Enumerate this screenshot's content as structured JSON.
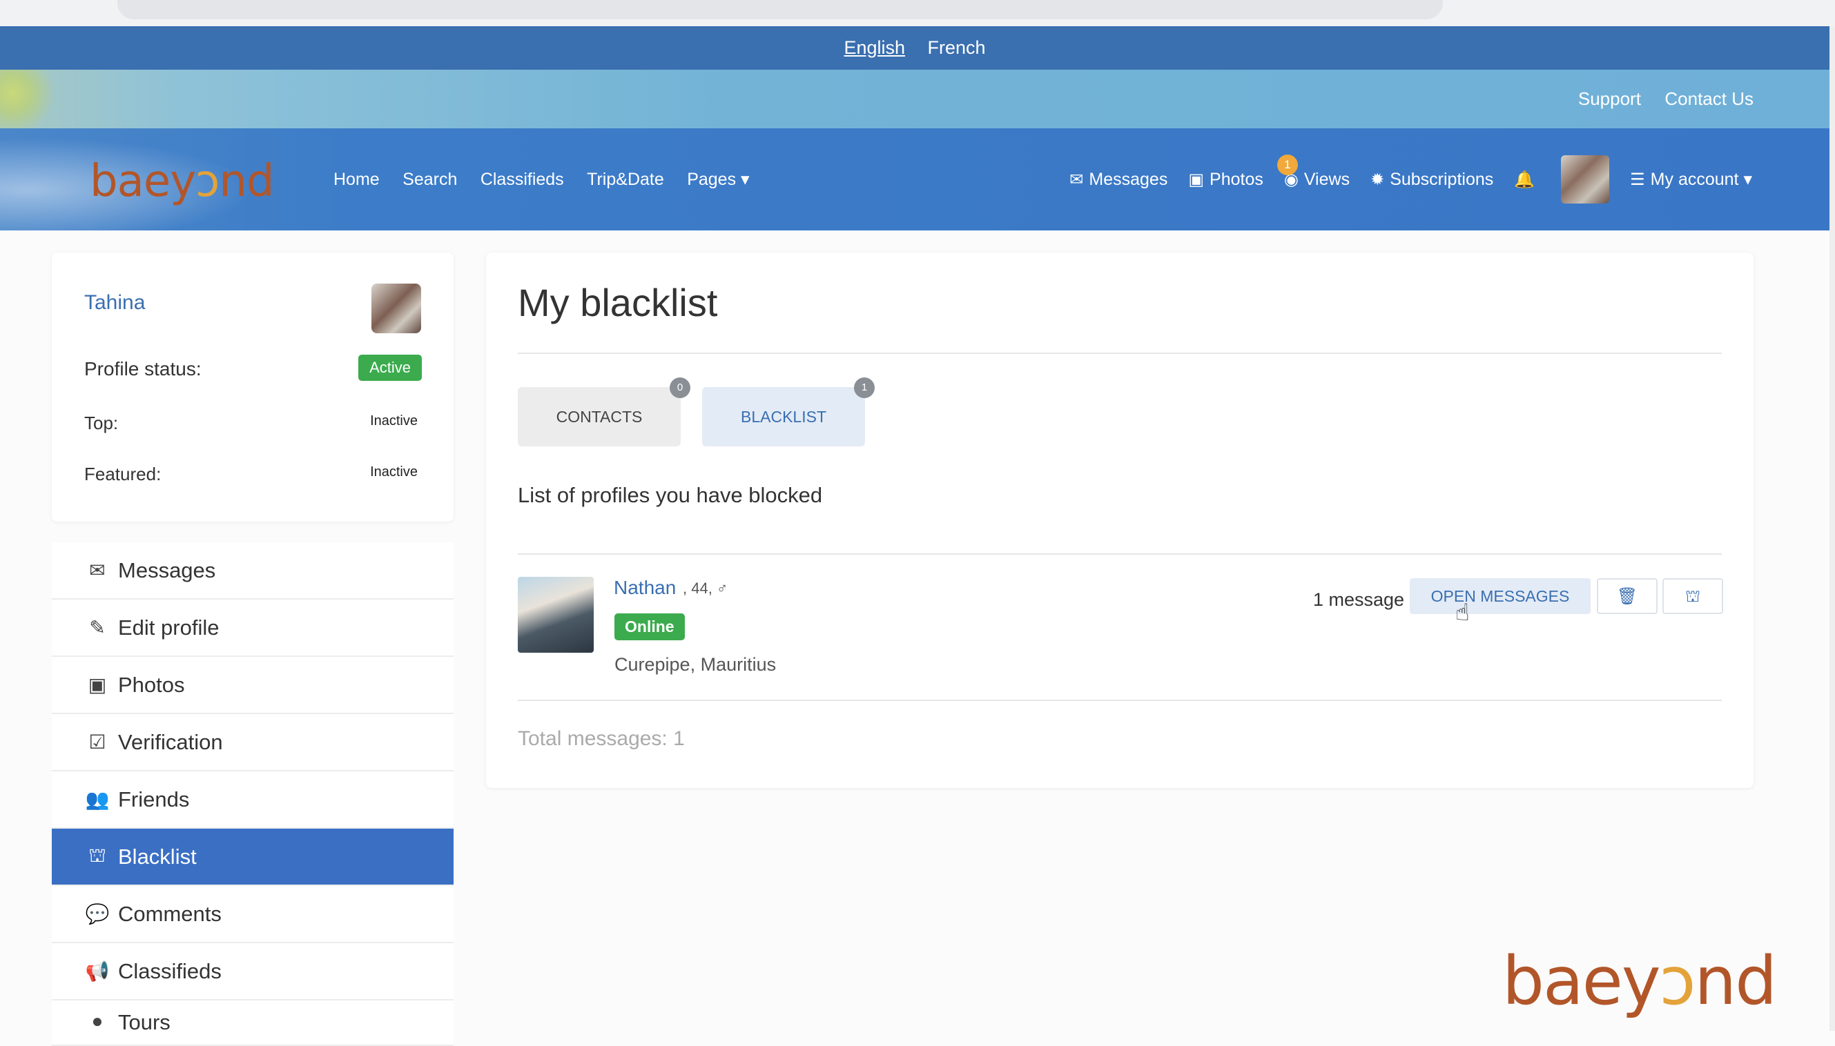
{
  "language_bar": {
    "english": "English",
    "french": "French"
  },
  "top_links": {
    "support": "Support",
    "contact": "Contact Us"
  },
  "brand": {
    "logo_text_a": "baey",
    "logo_text_o": "ɔ",
    "logo_text_b": "nd"
  },
  "nav": {
    "home": "Home",
    "search": "Search",
    "classifieds": "Classifieds",
    "tripdate": "Trip&Date",
    "pages": "Pages ▾",
    "messages": "Messages",
    "photos": "Photos",
    "views": "Views",
    "views_badge": "1",
    "subscriptions": "Subscriptions",
    "my_account": "My account ▾"
  },
  "profile": {
    "name": "Tahina",
    "status_label": "Profile status:",
    "status_value": "Active",
    "top_label": "Top:",
    "top_value": "Inactive",
    "featured_label": "Featured:",
    "featured_value": "Inactive"
  },
  "menu": {
    "messages": "Messages",
    "edit_profile": "Edit profile",
    "photos": "Photos",
    "verification": "Verification",
    "friends": "Friends",
    "blacklist": "Blacklist",
    "comments": "Comments",
    "classifieds": "Classifieds",
    "tours": "Tours"
  },
  "main": {
    "title": "My blacklist",
    "tab_contacts": "CONTACTS",
    "tab_contacts_count": "0",
    "tab_blacklist": "BLACKLIST",
    "tab_blacklist_count": "1",
    "intro": "List of profiles you have blocked",
    "user": {
      "name": "Nathan",
      "meta": ", 44, ♂",
      "status": "Online",
      "location": "Curepipe, Mauritius"
    },
    "message_count": "1 message",
    "open_messages": "OPEN MESSAGES",
    "total": "Total messages: 1"
  },
  "colors": {
    "brand_blue": "#3a6fb0",
    "active_green": "#3bab4d",
    "logo_brown": "#b2562a"
  }
}
